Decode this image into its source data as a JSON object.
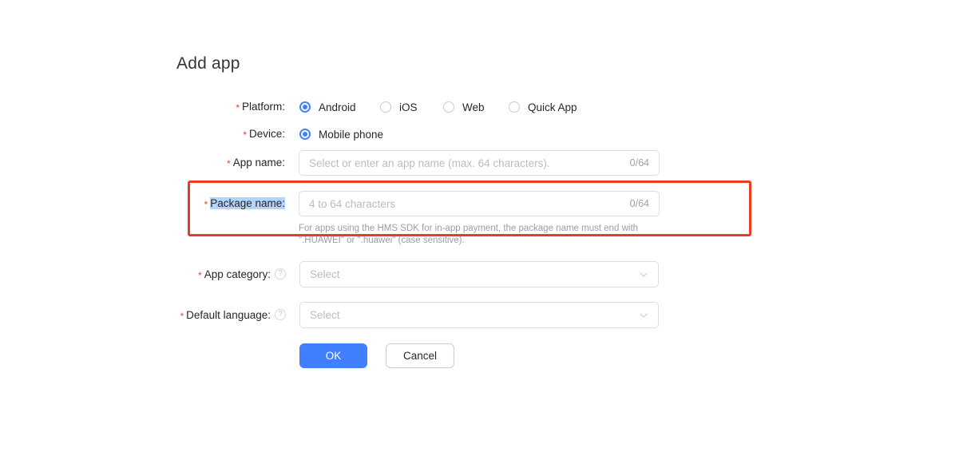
{
  "page": {
    "title": "Add app",
    "accent_color": "#4080ff",
    "required_star_color": "#e8472c",
    "annotation_color": "#ea3c1f",
    "selection_highlight_color": "#b3d4fc"
  },
  "form": {
    "platform": {
      "label": "Platform:",
      "required": true,
      "options": [
        {
          "label": "Android",
          "selected": true
        },
        {
          "label": "iOS",
          "selected": false
        },
        {
          "label": "Web",
          "selected": false
        },
        {
          "label": "Quick App",
          "selected": false
        }
      ]
    },
    "device": {
      "label": "Device:",
      "required": true,
      "options": [
        {
          "label": "Mobile phone",
          "selected": true
        }
      ]
    },
    "app_name": {
      "label": "App name:",
      "required": true,
      "placeholder": "Select or enter an app name (max. 64 characters).",
      "value": "",
      "counter": "0/64"
    },
    "package_name": {
      "label": "Package name:",
      "required": true,
      "label_selected": true,
      "placeholder": "4 to 64 characters",
      "value": "",
      "counter": "0/64",
      "helper_line1": "For apps using the HMS SDK for in-app payment, the package name must end with",
      "helper_line2": "\".HUAWEI\" or \".huawei\" (case sensitive)."
    },
    "app_category": {
      "label": "App category:",
      "required": true,
      "help_icon": "question-mark-icon",
      "placeholder": "Select",
      "value": "",
      "chevron": "chevron-down-icon"
    },
    "default_language": {
      "label": "Default language:",
      "required": true,
      "help_icon": "question-mark-icon",
      "placeholder": "Select",
      "value": "",
      "chevron": "chevron-down-icon"
    }
  },
  "actions": {
    "ok_label": "OK",
    "cancel_label": "Cancel"
  }
}
